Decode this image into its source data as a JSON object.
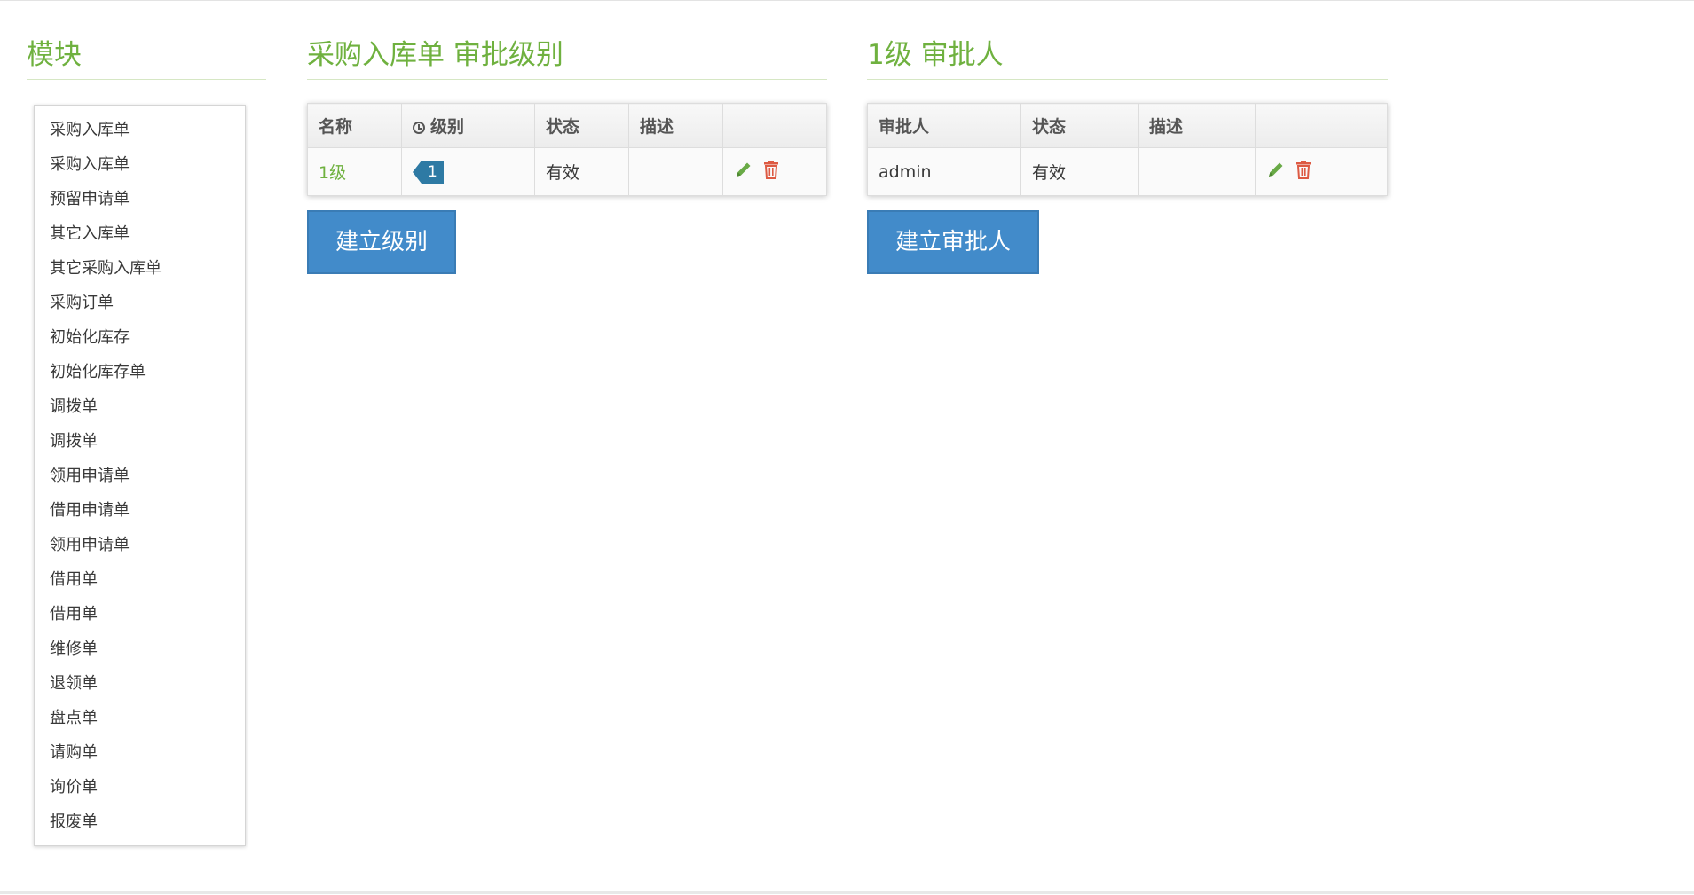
{
  "module_panel": {
    "title": "模块",
    "items": [
      "采购入库单",
      "采购入库单",
      "预留申请单",
      "其它入库单",
      "其它采购入库单",
      "采购订单",
      "初始化库存",
      "初始化库存单",
      "调拨单",
      "调拨单",
      "领用申请单",
      "借用申请单",
      "领用申请单",
      "借用单",
      "借用单",
      "维修单",
      "退领单",
      "盘点单",
      "请购单",
      "询价单",
      "报废单"
    ]
  },
  "levels_panel": {
    "title": "采购入库单 审批级别",
    "headers": {
      "name": "名称",
      "level": "级别",
      "status": "状态",
      "description": "描述",
      "actions": ""
    },
    "rows": [
      {
        "name": "1级",
        "level": "1",
        "status": "有效",
        "description": ""
      }
    ],
    "create_button": "建立级别"
  },
  "approvers_panel": {
    "title": "1级 审批人",
    "headers": {
      "approver": "审批人",
      "status": "状态",
      "description": "描述",
      "actions": ""
    },
    "rows": [
      {
        "approver": "admin",
        "status": "有效",
        "description": ""
      }
    ],
    "create_button": "建立审批人"
  },
  "icons": {
    "level_header": "clock-icon",
    "edit": "pencil-icon",
    "delete": "trash-icon"
  },
  "colors": {
    "title_green": "#6fb13f",
    "edit_green": "#69aa46",
    "delete_red": "#dd5a43",
    "button_blue": "#428bca",
    "badge_blue": "#2e7aa4"
  }
}
